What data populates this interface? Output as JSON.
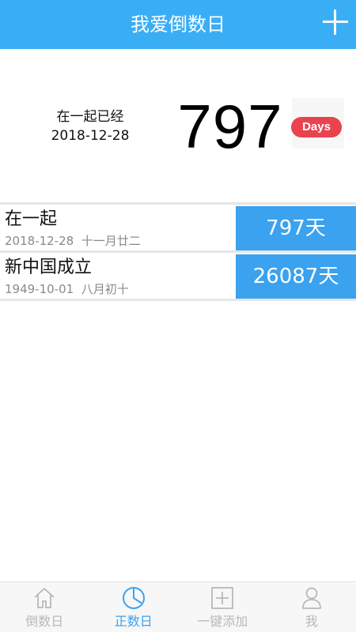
{
  "header": {
    "title": "我爱倒数日",
    "add_icon": "plus-icon"
  },
  "hero": {
    "caption": "在一起已经",
    "date": "2018-12-28",
    "count": "797",
    "badge": "Days"
  },
  "list": [
    {
      "title": "在一起",
      "date": "2018-12-28",
      "lunar": "十一月廿二",
      "days": "797天"
    },
    {
      "title": "新中国成立",
      "date": "1949-10-01",
      "lunar": "八月初十",
      "days": "26087天"
    }
  ],
  "bottom_nav": [
    {
      "label": "倒数日",
      "icon": "home-icon",
      "active": false
    },
    {
      "label": "正数日",
      "icon": "clock-icon",
      "active": true
    },
    {
      "label": "一键添加",
      "icon": "add-box-icon",
      "active": false
    },
    {
      "label": "我",
      "icon": "user-icon",
      "active": false
    }
  ],
  "colors": {
    "primary": "#3aaef4",
    "badge": "#e8434f",
    "row_badge": "#3aa2ee",
    "inactive": "#b8b8b8"
  }
}
